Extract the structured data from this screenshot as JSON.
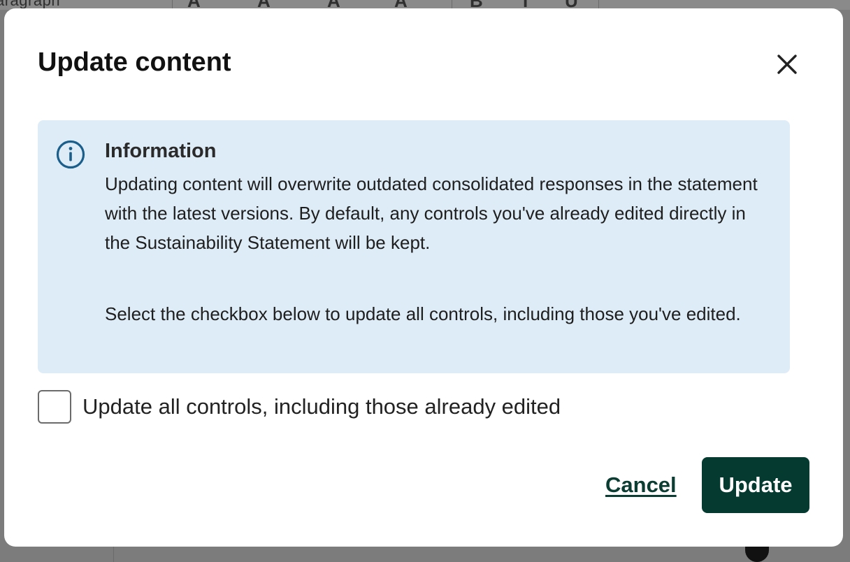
{
  "background": {
    "toolbar_paragraph": "aragraph",
    "toolbar_glyphs": [
      "A",
      "A",
      "A",
      "A",
      "B",
      "I",
      "U"
    ]
  },
  "dialog": {
    "title": "Update content",
    "close_icon": "close-icon",
    "info": {
      "icon": "info-icon",
      "title": "Information",
      "body_1": "Updating content will overwrite outdated consolidated responses in the statement with the latest versions. By default, any controls you've already edited directly in the Sustainability Statement will be kept.",
      "body_2": "Select the checkbox below to update all controls, including those you've edited."
    },
    "checkbox": {
      "label": "Update all controls, including those already edited",
      "checked": false
    },
    "cancel_label": "Cancel",
    "update_label": "Update"
  },
  "colors": {
    "primary": "#053a30",
    "info_bg": "#deecf7",
    "info_icon": "#1a5f8c"
  }
}
